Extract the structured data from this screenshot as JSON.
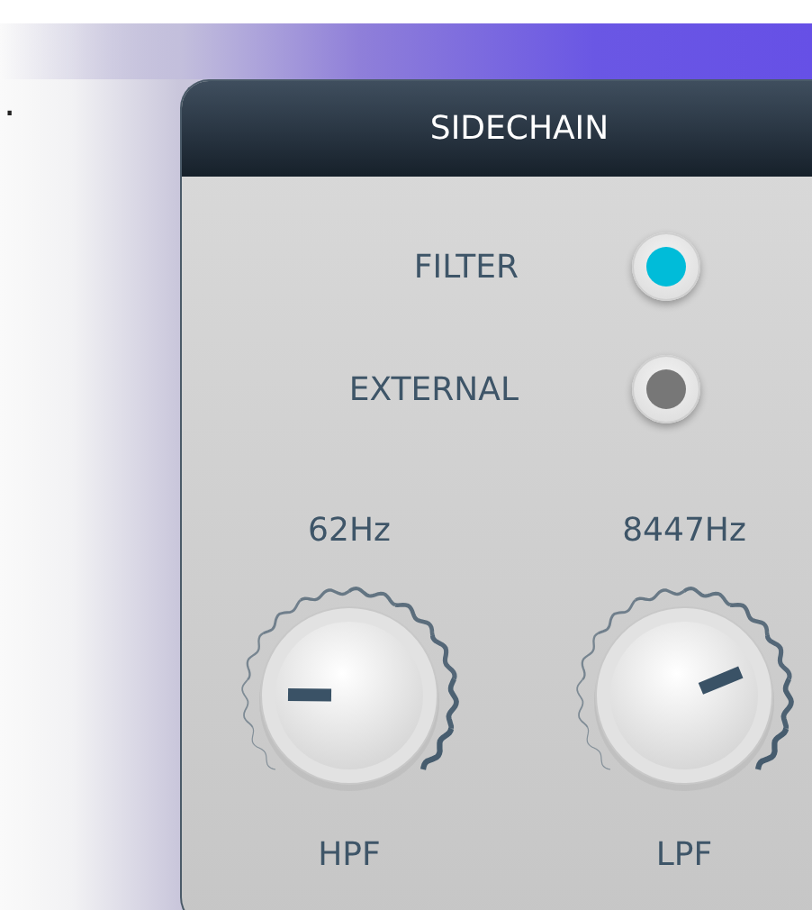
{
  "page_fragments": [
    "."
  ],
  "panel": {
    "title": "SIDECHAIN",
    "sources": [
      {
        "label": "FILTER",
        "selected": true
      },
      {
        "label": "EXTERNAL",
        "selected": false
      }
    ],
    "knobs": [
      {
        "label": "HPF",
        "value": "62Hz",
        "level": 0.17
      },
      {
        "label": "LPF",
        "value": "8447Hz",
        "level": 0.75
      }
    ]
  }
}
